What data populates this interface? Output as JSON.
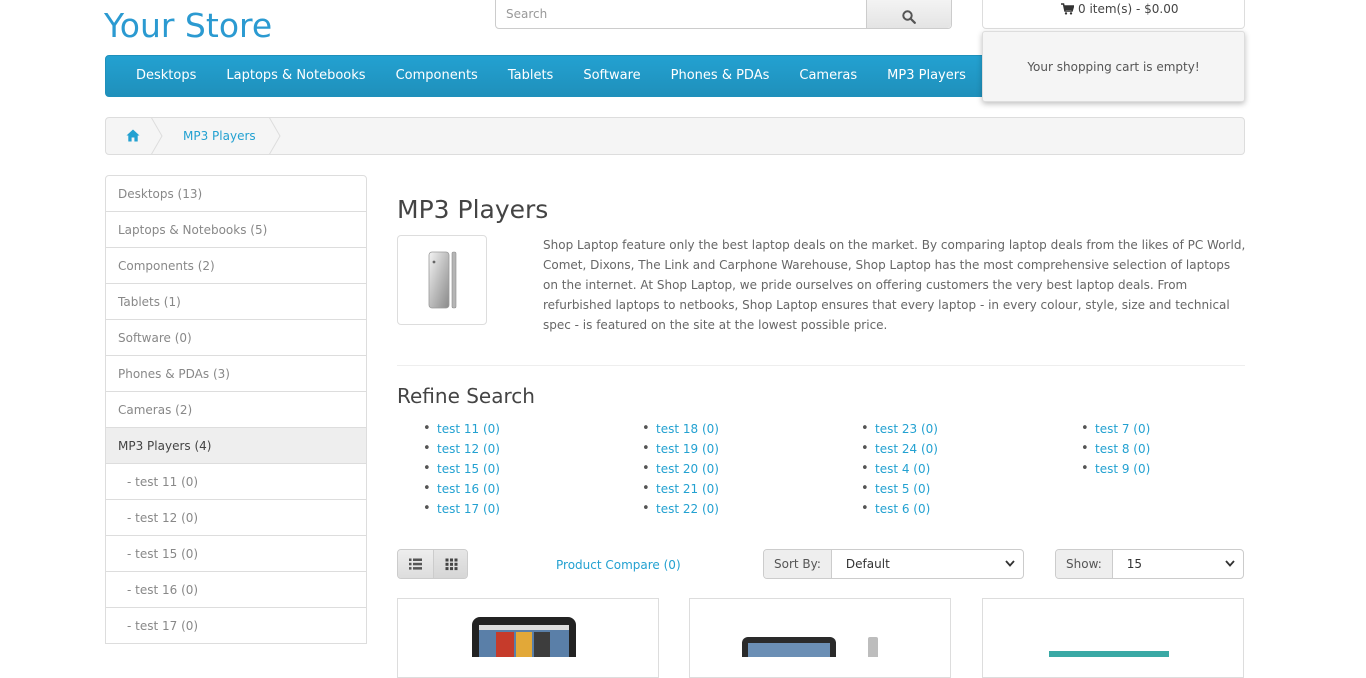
{
  "header": {
    "logo": "Your Store",
    "search_placeholder": "Search",
    "cart_label": "0 item(s) - $0.00",
    "cart_empty": "Your shopping cart is empty!"
  },
  "menu": [
    "Desktops",
    "Laptops & Notebooks",
    "Components",
    "Tablets",
    "Software",
    "Phones & PDAs",
    "Cameras",
    "MP3 Players"
  ],
  "breadcrumb": {
    "current": "MP3 Players"
  },
  "sidebar": [
    {
      "label": "Desktops (13)",
      "active": false,
      "sub": false
    },
    {
      "label": "Laptops & Notebooks (5)",
      "active": false,
      "sub": false
    },
    {
      "label": "Components (2)",
      "active": false,
      "sub": false
    },
    {
      "label": "Tablets (1)",
      "active": false,
      "sub": false
    },
    {
      "label": "Software (0)",
      "active": false,
      "sub": false
    },
    {
      "label": "Phones & PDAs (3)",
      "active": false,
      "sub": false
    },
    {
      "label": "Cameras (2)",
      "active": false,
      "sub": false
    },
    {
      "label": "MP3 Players (4)",
      "active": true,
      "sub": false
    },
    {
      "label": "- test 11 (0)",
      "active": false,
      "sub": true
    },
    {
      "label": "- test 12 (0)",
      "active": false,
      "sub": true
    },
    {
      "label": "- test 15 (0)",
      "active": false,
      "sub": true
    },
    {
      "label": "- test 16 (0)",
      "active": false,
      "sub": true
    },
    {
      "label": "- test 17 (0)",
      "active": false,
      "sub": true
    }
  ],
  "main": {
    "title": "MP3 Players",
    "description": "Shop Laptop feature only the best laptop deals on the market. By comparing laptop deals from the likes of PC World, Comet, Dixons, The Link and Carphone Warehouse, Shop Laptop has the most comprehensive selection of laptops on the internet. At Shop Laptop, we pride ourselves on offering customers the very best laptop deals. From refurbished laptops to netbooks, Shop Laptop ensures that every laptop - in every colour, style, size and technical spec - is featured on the site at the lowest possible price.",
    "refine_title": "Refine Search",
    "refine_columns": [
      [
        "test 11 (0)",
        "test 12 (0)",
        "test 15 (0)",
        "test 16 (0)",
        "test 17 (0)"
      ],
      [
        "test 18 (0)",
        "test 19 (0)",
        "test 20 (0)",
        "test 21 (0)",
        "test 22 (0)"
      ],
      [
        "test 23 (0)",
        "test 24 (0)",
        "test 4 (0)",
        "test 5 (0)",
        "test 6 (0)"
      ],
      [
        "test 7 (0)",
        "test 8 (0)",
        "test 9 (0)"
      ]
    ],
    "compare": "Product Compare (0)",
    "sort_label": "Sort By:",
    "sort_value": "Default",
    "show_label": "Show:",
    "show_value": "15"
  },
  "colors": {
    "accent": "#23a1d1",
    "menu": "#229ac8"
  }
}
